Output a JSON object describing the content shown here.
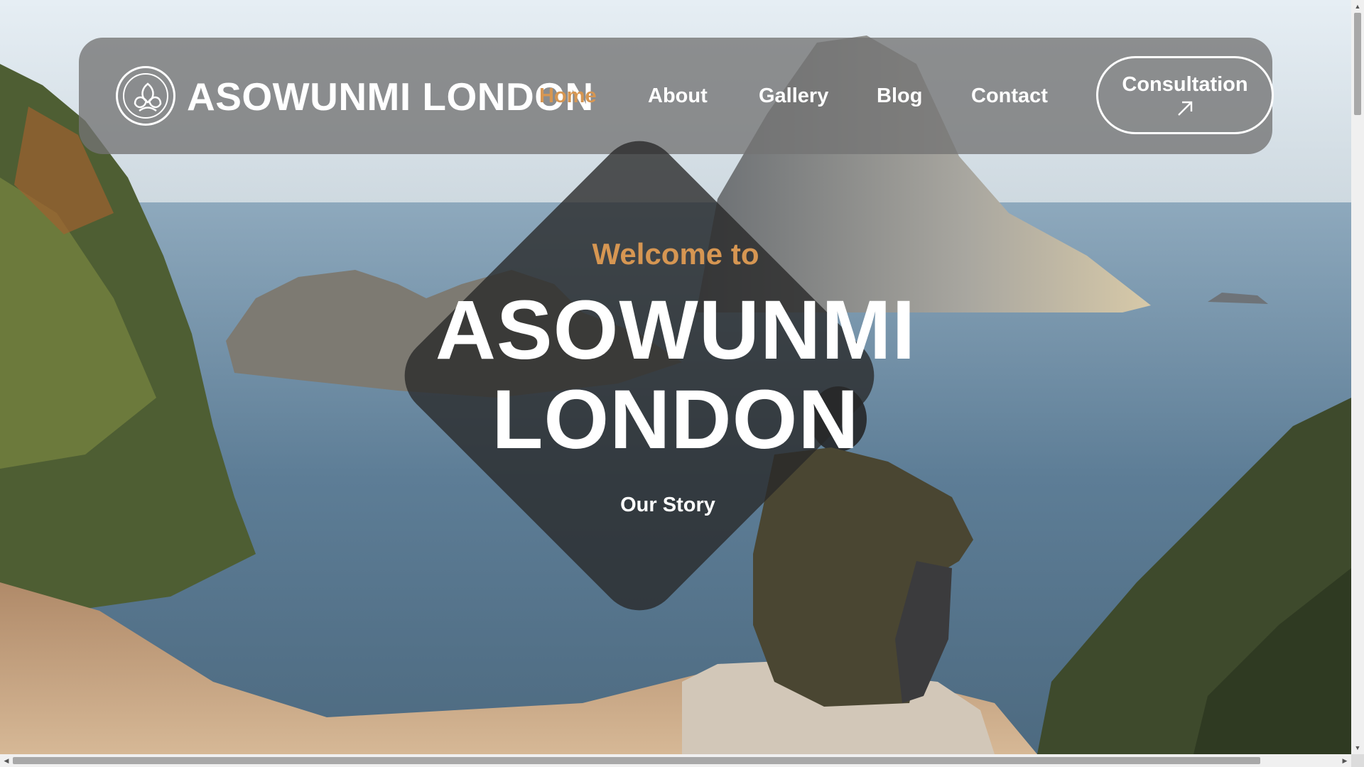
{
  "brand": {
    "name": "ASOWUNMI LONDON",
    "logo_icon": "lotus-leaf-icon"
  },
  "nav": {
    "items": [
      {
        "label": "Home",
        "active": true
      },
      {
        "label": "About",
        "active": false
      },
      {
        "label": "Gallery",
        "active": false
      },
      {
        "label": "Blog",
        "active": false
      },
      {
        "label": "Contact",
        "active": false
      }
    ],
    "cta_label": "Consultation",
    "cta_icon": "arrow-up-right-icon"
  },
  "hero": {
    "welcome": "Welcome to",
    "title_line1": "ASOWUNMI",
    "title_line2": "LONDON",
    "link": "Our Story"
  },
  "colors": {
    "accent": "#d69652",
    "navbar_bg": "#737373",
    "diamond_bg": "#282828",
    "text": "#ffffff"
  },
  "scrollbars": {
    "vertical_up_icon": "scroll-up-arrow-icon",
    "vertical_down_icon": "scroll-down-arrow-icon",
    "horizontal_left_icon": "scroll-left-arrow-icon",
    "horizontal_right_icon": "scroll-right-arrow-icon"
  }
}
